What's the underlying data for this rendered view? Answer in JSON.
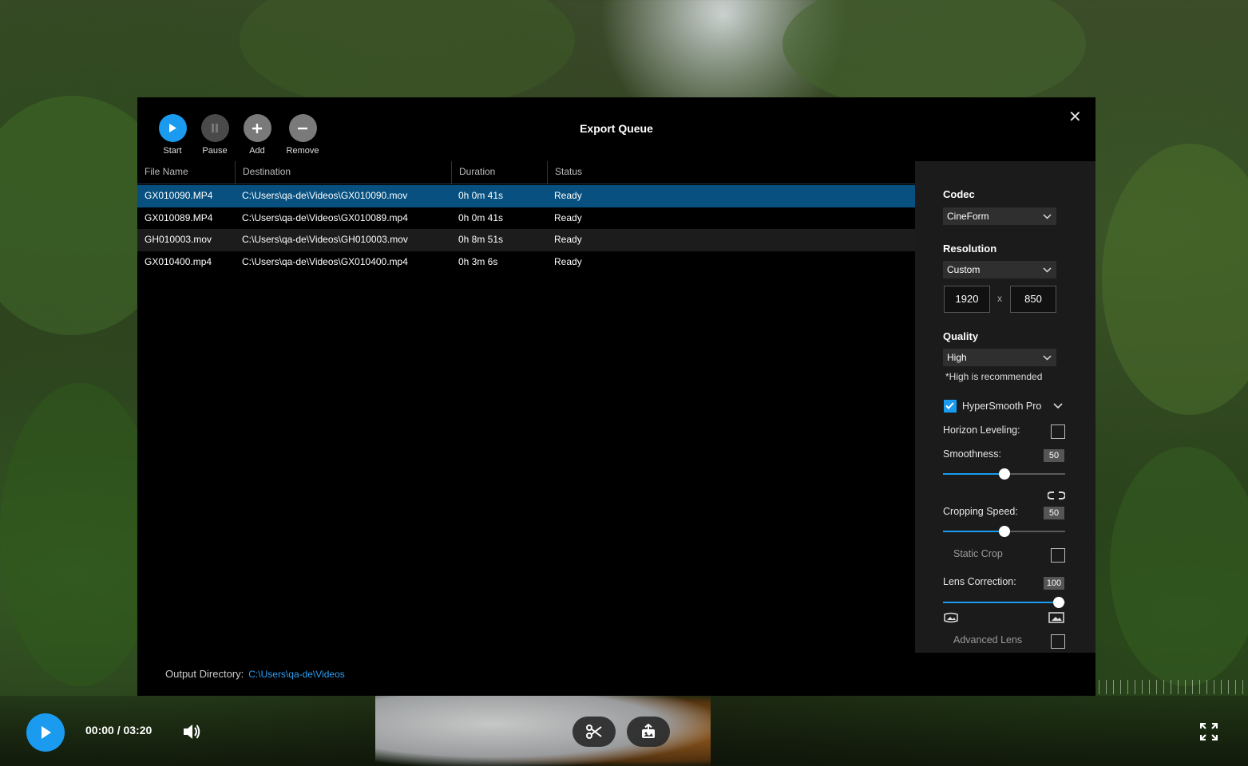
{
  "dialog": {
    "title": "Export Queue",
    "toolbar": [
      {
        "label": "Start",
        "icon": "play-icon",
        "color": "#1a9bf0"
      },
      {
        "label": "Pause",
        "icon": "pause-icon",
        "color": "#4a4a4a"
      },
      {
        "label": "Add",
        "icon": "plus-icon",
        "color": "#7a7a7a"
      },
      {
        "label": "Remove",
        "icon": "minus-icon",
        "color": "#7a7a7a"
      }
    ],
    "columns": [
      "File Name",
      "Destination",
      "Duration",
      "Status"
    ],
    "rows": [
      {
        "file": "GX010090.MP4",
        "destination": "C:\\Users\\qa-de\\Videos\\GX010090.mov",
        "duration": "0h 0m 41s",
        "status": "Ready",
        "selected": true
      },
      {
        "file": "GX010089.MP4",
        "destination": "C:\\Users\\qa-de\\Videos\\GX010089.mp4",
        "duration": "0h 0m 41s",
        "status": "Ready"
      },
      {
        "file": "GH010003.mov",
        "destination": "C:\\Users\\qa-de\\Videos\\GH010003.mov",
        "duration": "0h 8m 51s",
        "status": "Ready"
      },
      {
        "file": "GX010400.mp4",
        "destination": "C:\\Users\\qa-de\\Videos\\GX010400.mp4",
        "duration": "0h 3m 6s",
        "status": "Ready"
      }
    ],
    "output_label": "Output Directory:",
    "output_path": "C:\\Users\\qa-de\\Videos"
  },
  "settings": {
    "codec_label": "Codec",
    "codec_value": "CineForm",
    "resolution_label": "Resolution",
    "resolution_value": "Custom",
    "width": "1920",
    "height": "850",
    "x_sep": "x",
    "quality_label": "Quality",
    "quality_value": "High",
    "quality_note": "*High is recommended",
    "hypersmooth_label": "HyperSmooth Pro",
    "hypersmooth_checked": true,
    "horizon_label": "Horizon Leveling:",
    "smoothness_label": "Smoothness:",
    "smoothness_value": "50",
    "cropping_label": "Cropping Speed:",
    "cropping_value": "50",
    "static_crop_label": "Static Crop",
    "lens_label": "Lens Correction:",
    "lens_value": "100",
    "advanced_lens_label": "Advanced Lens"
  },
  "player": {
    "time": "00:00 / 03:20",
    "accent": "#1a9bf0"
  }
}
